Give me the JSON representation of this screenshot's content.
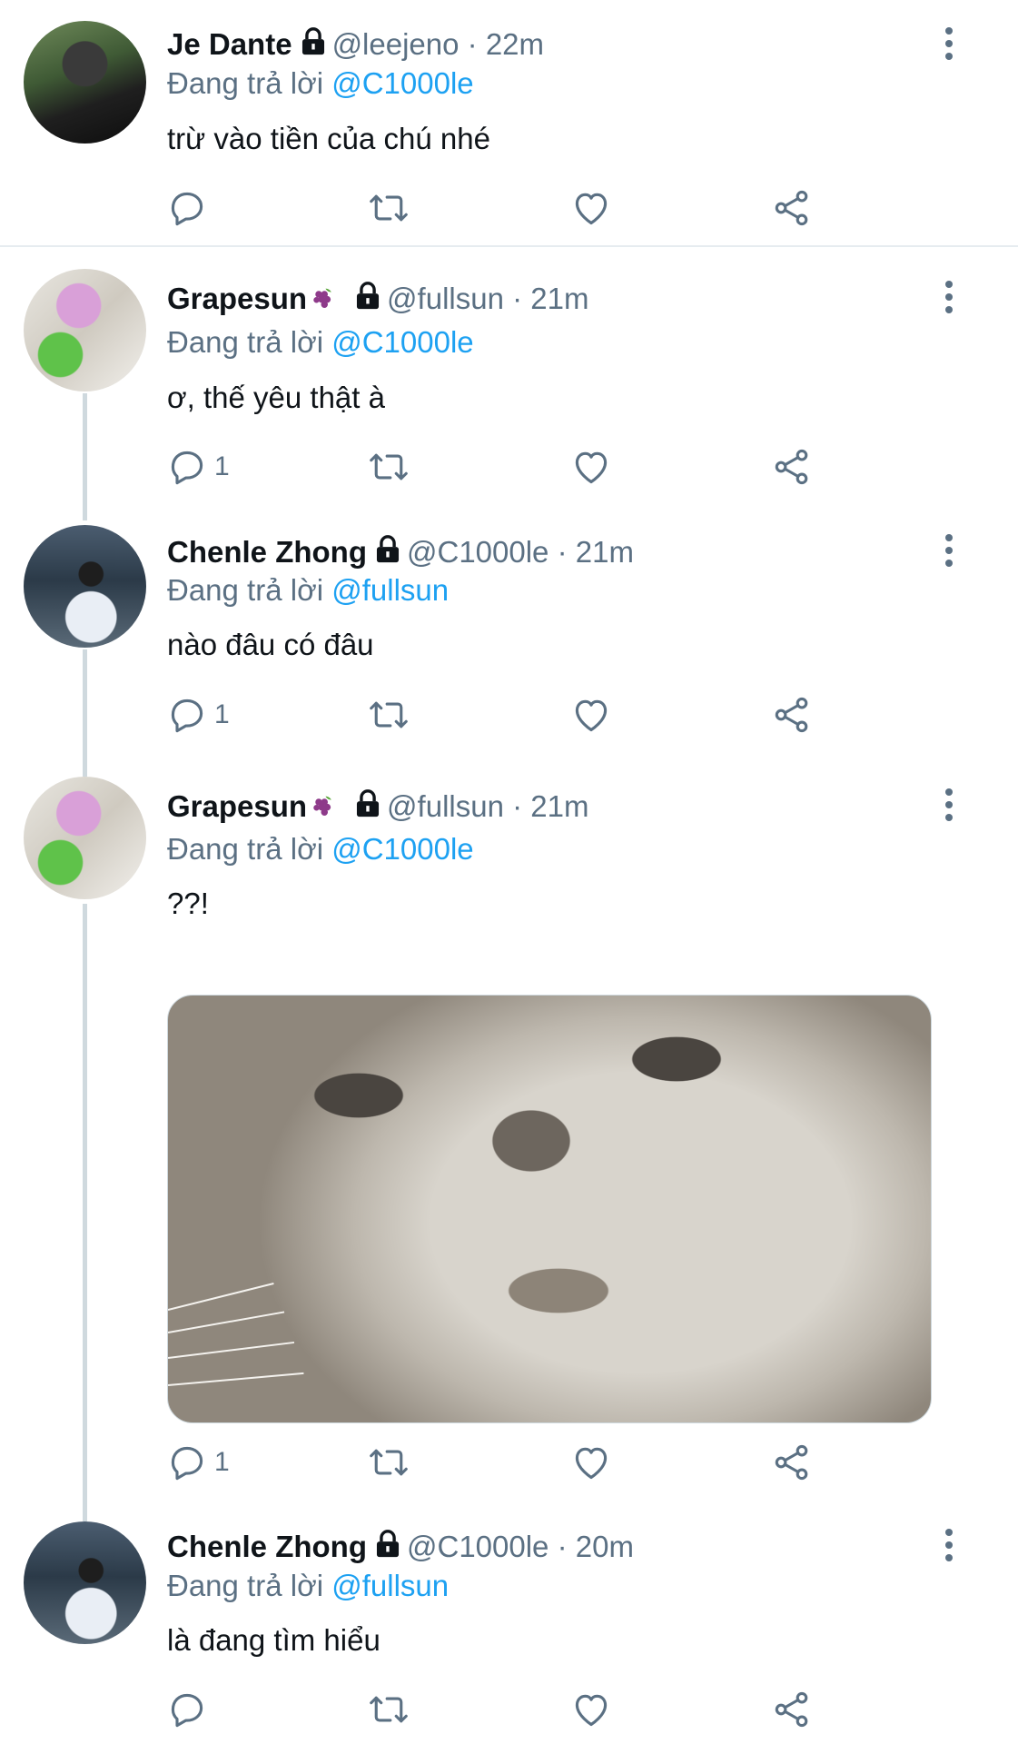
{
  "tweets": [
    {
      "name": "Je Dante",
      "handle": "@leejeno",
      "time": "· 22m",
      "reply_prefix": "Đang trả lời",
      "reply_to": "@C1000le",
      "text": "trừ vào tiền của chú nhé",
      "reply_count": ""
    },
    {
      "name": "Grapesun",
      "handle": "@fullsun",
      "time": "· 21m",
      "reply_prefix": "Đang trả lời",
      "reply_to": "@C1000le",
      "text": "ơ, thế yêu thật à",
      "reply_count": "1"
    },
    {
      "name": "Chenle Zhong",
      "handle": "@C1000le",
      "time": "· 21m",
      "reply_prefix": "Đang trả lời",
      "reply_to": "@fullsun",
      "text": "nào đâu có đâu",
      "reply_count": "1"
    },
    {
      "name": "Grapesun",
      "handle": "@fullsun",
      "time": "· 21m",
      "reply_prefix": "Đang trả lời",
      "reply_to": "@C1000le",
      "text": "??!",
      "reply_count": "1"
    },
    {
      "name": "Chenle Zhong",
      "handle": "@C1000le",
      "time": "· 20m",
      "reply_prefix": "Đang trả lời",
      "reply_to": "@fullsun",
      "text": "là đang tìm hiểu",
      "reply_count": ""
    }
  ],
  "icons": {
    "reply": "reply-icon",
    "retweet": "retweet-icon",
    "like": "heart-icon",
    "share": "share-icon",
    "more": "more-vertical-icon",
    "lock": "lock-icon",
    "grape": "grape-emoji-icon"
  },
  "colors": {
    "mention": "#1da1f2",
    "meta": "#5b7083",
    "text": "#0f1419",
    "line": "#cfd9de"
  }
}
